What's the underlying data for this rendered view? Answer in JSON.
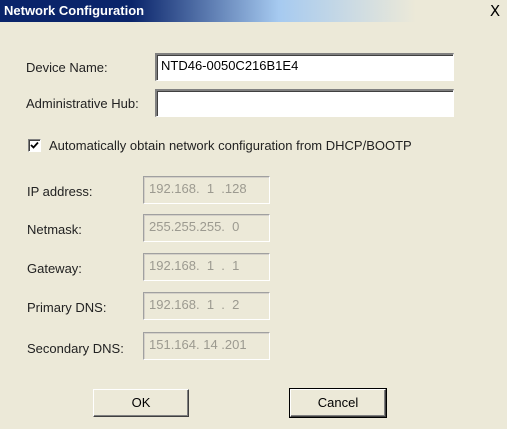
{
  "window": {
    "title": "Network Configuration",
    "close_glyph": "X"
  },
  "form": {
    "device_name": {
      "label": "Device Name:",
      "value": "NTD46-0050C216B1E4"
    },
    "admin_hub": {
      "label": "Administrative Hub:",
      "value": ""
    },
    "dhcp": {
      "label": "Automatically obtain network configuration from DHCP/BOOTP",
      "checked": true
    },
    "ip_address": {
      "label": "IP address:",
      "value": "192.168.  1  .128"
    },
    "netmask": {
      "label": "Netmask:",
      "value": "255.255.255.  0"
    },
    "gateway": {
      "label": "Gateway:",
      "value": "192.168.  1  .  1"
    },
    "primary_dns": {
      "label": "Primary DNS:",
      "value": "192.168.  1  .  2"
    },
    "secondary_dns": {
      "label": "Secondary DNS:",
      "value": "151.164. 14 .201"
    }
  },
  "buttons": {
    "ok": "OK",
    "cancel": "Cancel"
  }
}
